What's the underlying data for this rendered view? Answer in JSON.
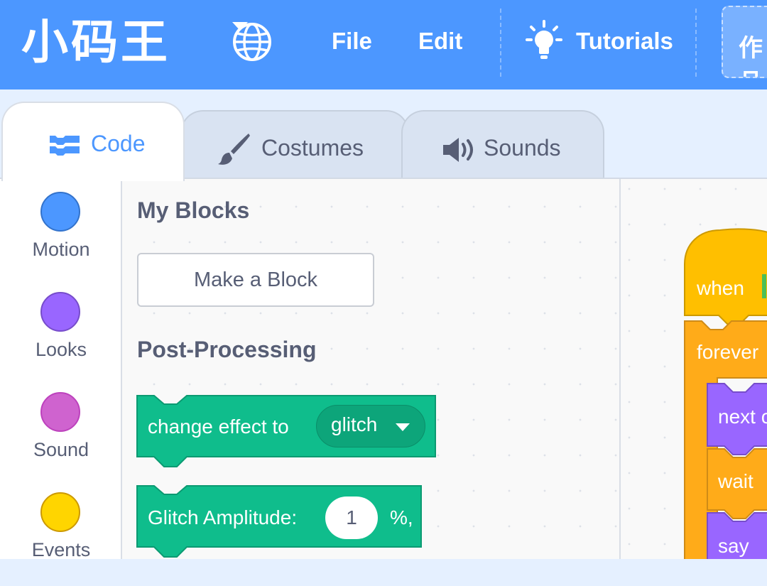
{
  "menubar": {
    "logo_text": "小码王",
    "language_icon": "globe-icon",
    "file_label": "File",
    "edit_label": "Edit",
    "tutorials_label": "Tutorials",
    "tutorials_icon": "lightbulb-icon",
    "project_label": "作品",
    "bg_color": "#4c97ff"
  },
  "tabs": [
    {
      "label": "Code",
      "icon": "code-blocks-icon",
      "active": true
    },
    {
      "label": "Costumes",
      "icon": "paintbrush-icon",
      "active": false
    },
    {
      "label": "Sounds",
      "icon": "speaker-icon",
      "active": false
    }
  ],
  "categories": [
    {
      "label": "Motion",
      "color": "#4c97ff"
    },
    {
      "label": "Looks",
      "color": "#9966ff"
    },
    {
      "label": "Sound",
      "color": "#cf63cf"
    },
    {
      "label": "Events",
      "color": "#ffd500"
    }
  ],
  "palette": {
    "my_blocks_title": "My Blocks",
    "make_block_label": "Make a Block",
    "post_processing_title": "Post-Processing",
    "change_effect": {
      "text": "change effect to",
      "value": "glitch",
      "color": "#0fbd8c"
    },
    "glitch_amplitude": {
      "text": "Glitch Amplitude:",
      "value": "1",
      "suffix": "%,",
      "color": "#0fbd8c"
    }
  },
  "script": {
    "hat_text": "when",
    "forever_text": "forever",
    "stack_texts": [
      "next c",
      "wait",
      "say"
    ],
    "colors": {
      "events": "#ffbf00",
      "control": "#ffab19",
      "looks": "#9966ff",
      "flag": "#4cbf56"
    }
  }
}
